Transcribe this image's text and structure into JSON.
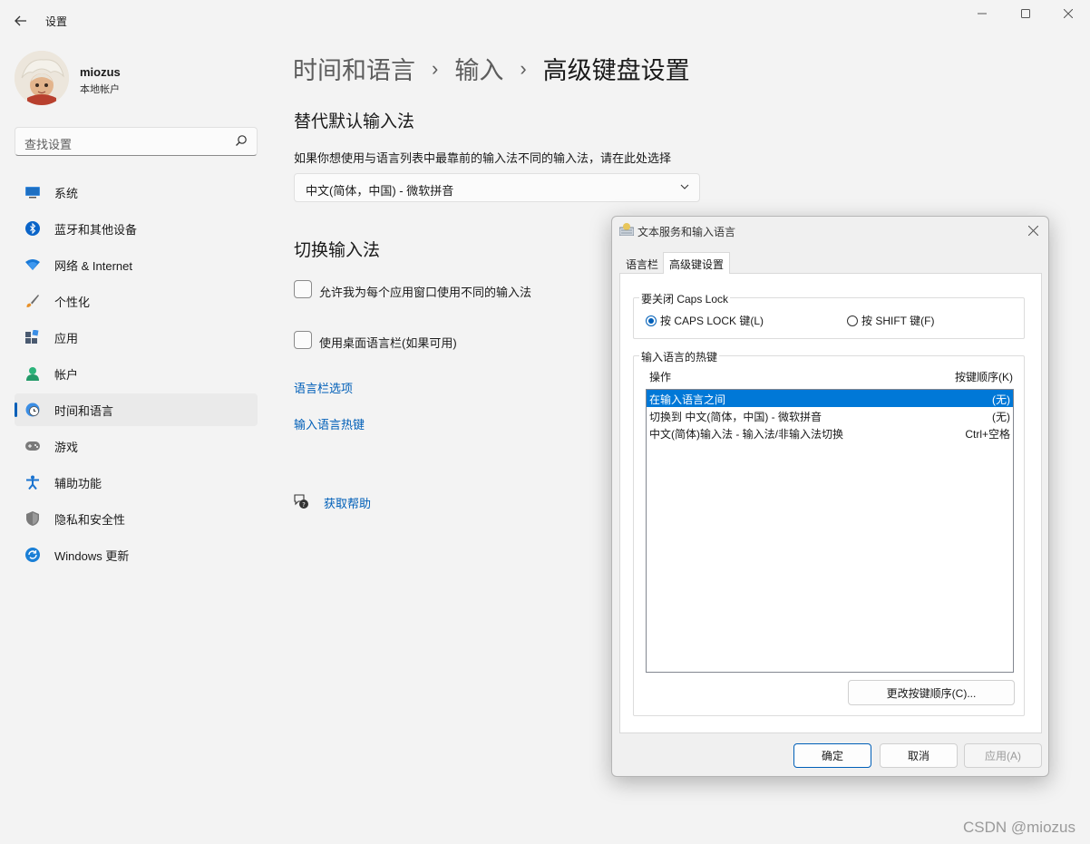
{
  "window": {
    "title": "设置",
    "controls": [
      "minimize",
      "maximize",
      "close"
    ]
  },
  "user": {
    "name": "miozus",
    "account_type": "本地帐户"
  },
  "search": {
    "placeholder": "查找设置"
  },
  "sidebar": {
    "items": [
      {
        "label": "系统",
        "icon": "system-icon"
      },
      {
        "label": "蓝牙和其他设备",
        "icon": "bluetooth-icon"
      },
      {
        "label": "网络 & Internet",
        "icon": "wifi-icon"
      },
      {
        "label": "个性化",
        "icon": "brush-icon"
      },
      {
        "label": "应用",
        "icon": "apps-icon"
      },
      {
        "label": "帐户",
        "icon": "account-icon"
      },
      {
        "label": "时间和语言",
        "icon": "clock-globe-icon",
        "active": true
      },
      {
        "label": "游戏",
        "icon": "gamepad-icon"
      },
      {
        "label": "辅助功能",
        "icon": "accessibility-icon"
      },
      {
        "label": "隐私和安全性",
        "icon": "shield-icon"
      },
      {
        "label": "Windows 更新",
        "icon": "update-icon"
      }
    ]
  },
  "breadcrumb": {
    "part1": "时间和语言",
    "part2": "输入",
    "part3": "高级键盘设置",
    "separator": "›"
  },
  "main": {
    "override_title": "替代默认输入法",
    "override_desc": "如果你想使用与语言列表中最靠前的输入法不同的输入法，请在此处选择",
    "override_value": "中文(简体，中国) - 微软拼音",
    "switch_title": "切换输入法",
    "checkbox1": "允许我为每个应用窗口使用不同的输入法",
    "checkbox2": "使用桌面语言栏(如果可用)",
    "link1": "语言栏选项",
    "link2": "输入语言热键",
    "help": "获取帮助"
  },
  "dialog": {
    "title": "文本服务和输入语言",
    "tabs": [
      "语言栏",
      "高级键设置"
    ],
    "caps_group_label": "要关闭 Caps Lock",
    "radio1": "按 CAPS LOCK 键(L)",
    "radio2": "按 SHIFT 键(F)",
    "radio_selected": "radio1",
    "hotkeys_group_label": "输入语言的热键",
    "col_action": "操作",
    "col_keys": "按键顺序(K)",
    "rows": [
      {
        "action": "在输入语言之间",
        "keys": "(无)",
        "selected": true
      },
      {
        "action": "切换到 中文(简体，中国) - 微软拼音",
        "keys": "(无)"
      },
      {
        "action": "中文(简体)输入法 - 输入法/非输入法切换",
        "keys": "Ctrl+空格"
      }
    ],
    "change_keys_button": "更改按键顺序(C)...",
    "ok": "确定",
    "cancel": "取消",
    "apply": "应用(A)"
  },
  "watermark": "CSDN @miozus",
  "colors": {
    "accent": "#005fb8",
    "selection": "#0078d7",
    "background": "#f3f3f3"
  }
}
